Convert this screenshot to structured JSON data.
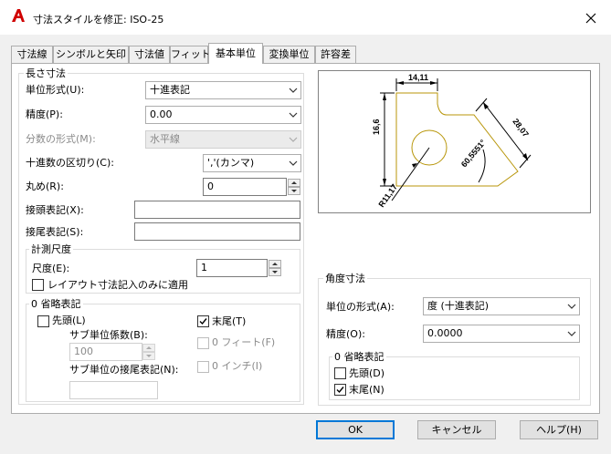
{
  "window": {
    "title": "寸法スタイルを修正: ISO-25"
  },
  "tabs": [
    "寸法線",
    "シンボルと矢印",
    "寸法値",
    "フィット",
    "基本単位",
    "変換単位",
    "許容差"
  ],
  "linear": {
    "group_title": "長さ寸法",
    "unit_format_label": "単位形式(U):",
    "unit_format_value": "十進表記",
    "precision_label": "精度(P):",
    "precision_value": "0.00",
    "fraction_label": "分数の形式(M):",
    "fraction_value": "水平線",
    "decimal_sep_label": "十進数の区切り(C):",
    "decimal_sep_value": "','(カンマ)",
    "roundoff_label": "丸め(R):",
    "roundoff_value": "0",
    "prefix_label": "接頭表記(X):",
    "prefix_value": "",
    "suffix_label": "接尾表記(S):",
    "suffix_value": ""
  },
  "measurement": {
    "group_title": "計測尺度",
    "scale_label": "尺度(E):",
    "scale_value": "1",
    "layout_only_label": "レイアウト寸法記入のみに適用",
    "layout_only_checked": false
  },
  "zero_suppress": {
    "group_title": "0 省略表記",
    "leading_label": "先頭(L)",
    "leading_checked": false,
    "trailing_label": "末尾(T)",
    "trailing_checked": true,
    "sub_factor_label": "サブ単位係数(B):",
    "sub_factor_value": "100",
    "sub_suffix_label": "サブ単位の接尾表記(N):",
    "sub_suffix_value": "",
    "zero_feet_label": "0 フィート(F)",
    "zero_inch_label": "0 インチ(I)"
  },
  "preview": {
    "dim_top": "14,11",
    "dim_left": "16,6",
    "dim_right": "28,07",
    "dim_angle": "60,5551°",
    "dim_radius": "R11,17",
    "line_color": "#b8960a"
  },
  "angular": {
    "group_title": "角度寸法",
    "format_label": "単位の形式(A):",
    "format_value": "度 (十進表記)",
    "precision_label": "精度(O):",
    "precision_value": "0.0000",
    "zero_title": "0 省略表記",
    "leading_label": "先頭(D)",
    "leading_checked": false,
    "trailing_label": "末尾(N)",
    "trailing_checked": true
  },
  "buttons": {
    "ok": "OK",
    "cancel": "キャンセル",
    "help": "ヘルプ(H)"
  }
}
